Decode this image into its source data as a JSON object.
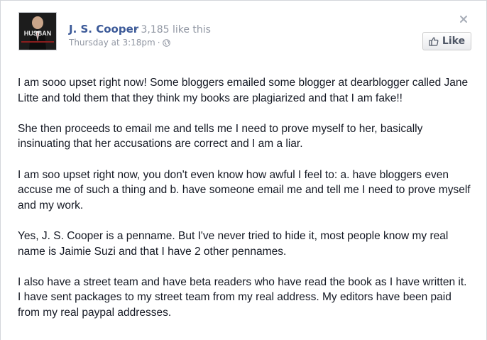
{
  "post": {
    "page_name": "J. S. Cooper",
    "like_count": "3,185 like this",
    "timestamp": "Thursday at 3:18pm",
    "audience_icon": "globe-icon",
    "like_button_label": "Like",
    "avatar_text": "HUSBAN",
    "paragraphs": [
      "I am sooo upset right now! Some bloggers emailed some blogger at dearblogger called Jane Litte and told them that they think my books are plagiarized and that I am fake!!",
      "She then proceeds to email me and tells me I need to prove myself to her, basically insinuating that her accusations are correct and I am a liar.",
      "I am soo upset right now, you don't even know how awful I feel to: a. have bloggers even accuse me of such a thing and b. have someone email me and tell me I need to prove myself and my work.",
      "Yes, J. S. Cooper is a penname. But I've never tried to hide it, most people know my real name is Jaimie Suzi and that I have 2 other pennames.",
      "I also have a street team and have beta readers who have read the book as I have written it. I have sent packages to my street team from my real address. My editors have been paid from my real paypal addresses."
    ]
  },
  "colors": {
    "link_blue": "#3b5998",
    "meta_gray": "#9197a3",
    "text_dark": "#141823",
    "button_text": "#4e5665"
  }
}
